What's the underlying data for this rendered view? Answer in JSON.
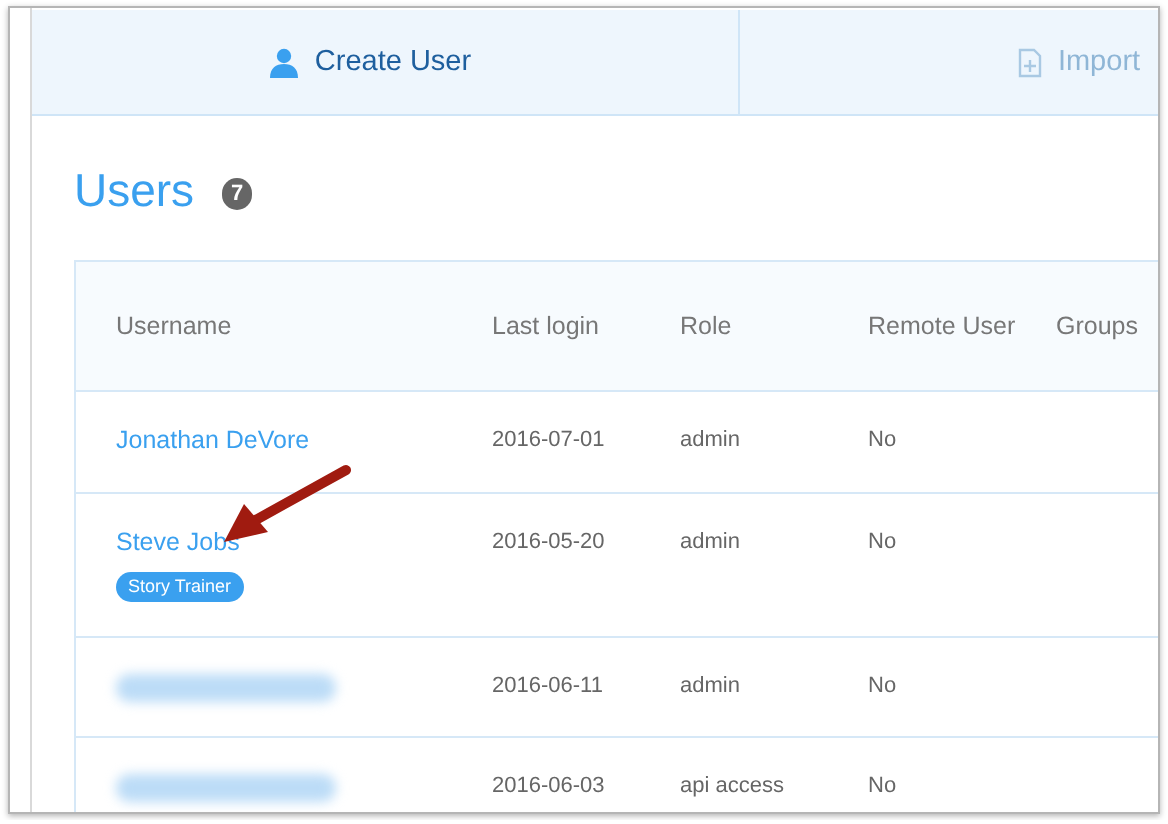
{
  "tabs": [
    {
      "label": "Create User",
      "kind": "person",
      "selected": true
    },
    {
      "label": "Import",
      "kind": "import",
      "selected": false
    }
  ],
  "heading": {
    "title": "Users",
    "count": "7"
  },
  "table": {
    "columns": [
      "Username",
      "Last login",
      "Role",
      "Remote User",
      "Groups"
    ],
    "rows": [
      {
        "username": "Jonathan DeVore",
        "redacted": false,
        "pointed_at": false,
        "last_login": "2016-07-01",
        "role": "admin",
        "remote_user": "No"
      },
      {
        "username": "Steve Jobs",
        "redacted": false,
        "pointed_at": true,
        "tag": "Story Trainer",
        "last_login": "2016-05-20",
        "role": "admin",
        "remote_user": "No"
      },
      {
        "redacted": true,
        "pointed_at": false,
        "last_login": "2016-06-11",
        "role": "admin",
        "remote_user": "No"
      },
      {
        "redacted": true,
        "pointed_at": false,
        "last_login": "2016-06-03",
        "role": "api access",
        "remote_user": "No"
      }
    ]
  }
}
